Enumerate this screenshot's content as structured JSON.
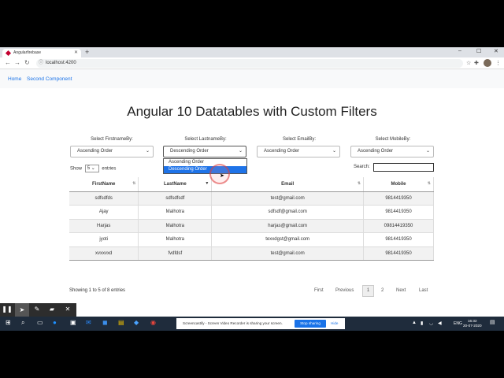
{
  "browser": {
    "tab_title": "Angularfirebase",
    "new_tab": "+",
    "url": "localhost:4200",
    "controls": {
      "minimize": "–",
      "maximize": "☐",
      "close": "✕"
    }
  },
  "appnav": {
    "home": "Home",
    "second": "Second Component"
  },
  "page_title": "Angular 10 Datatables with Custom Filters",
  "filters": [
    {
      "label": "Select FirstnameBy:",
      "value": "Ascending Order"
    },
    {
      "label": "Select LastnameBy:",
      "value": "Descending Order"
    },
    {
      "label": "Select EmailBy:",
      "value": "Ascending Order"
    },
    {
      "label": "Select MobileBy:",
      "value": "Ascending Order"
    }
  ],
  "dropdown_options": [
    "Ascending Order",
    "Descending Order"
  ],
  "length": {
    "show": "Show",
    "value": "5",
    "entries": "entries"
  },
  "search_label": "Search:",
  "table": {
    "headers": [
      "FirstName",
      "LastName",
      "Email",
      "Mobile"
    ],
    "rows": [
      [
        "sdfsdfds",
        "sdfsdfsdf",
        "test@gmail.com",
        "9814419350"
      ],
      [
        "Ajay",
        "Malhotra",
        "sdfsdf@gmail.com",
        "9814419350"
      ],
      [
        "Harjas",
        "Malhotra",
        "harjas@gmail.com",
        "09814419350"
      ],
      [
        "jyoti",
        "Malhotra",
        "texxdgst@gmail.com",
        "9814419350"
      ],
      [
        "xvxxvxd",
        "fvdfdsf",
        "test@gmail.com",
        "9814419350"
      ]
    ]
  },
  "info": "Showing 1 to 5 of 8 entries",
  "pager": {
    "first": "First",
    "previous": "Previous",
    "p1": "1",
    "p2": "2",
    "next": "Next",
    "last": "Last"
  },
  "taskbar": {
    "notice": "Screencastify - Screen Video Recorder is sharing your screen.",
    "stop": "Stop sharing",
    "hide": "Hide",
    "lang": "ENG",
    "time": "16:32",
    "date": "20-07-2020"
  }
}
